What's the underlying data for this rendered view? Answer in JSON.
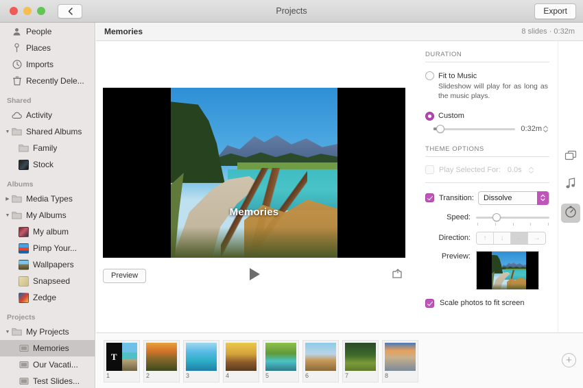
{
  "window": {
    "title": "Projects",
    "back_icon": "chevron-left-icon",
    "export_label": "Export",
    "traffic_lights": [
      "close",
      "minimize",
      "zoom"
    ]
  },
  "sidebar": {
    "items": [
      {
        "label": "People",
        "icon": "person-icon",
        "indent": 0,
        "disclosure": "none",
        "selected": false
      },
      {
        "label": "Places",
        "icon": "map-pin-icon",
        "indent": 0,
        "disclosure": "none",
        "selected": false
      },
      {
        "label": "Imports",
        "icon": "clock-icon",
        "indent": 0,
        "disclosure": "none",
        "selected": false
      },
      {
        "label": "Recently Dele...",
        "icon": "trash-icon",
        "indent": 0,
        "disclosure": "none",
        "selected": false
      }
    ],
    "sections": [
      {
        "header": "Shared",
        "items": [
          {
            "label": "Activity",
            "icon": "cloud-icon",
            "indent": 0,
            "disclosure": "none",
            "selected": false
          },
          {
            "label": "Shared Albums",
            "icon": "folder-icon",
            "indent": 0,
            "disclosure": "expanded",
            "selected": false
          },
          {
            "label": "Family",
            "icon": "folder-icon",
            "indent": 1,
            "disclosure": "none",
            "selected": false
          },
          {
            "label": "Stock",
            "icon": "album-thumbnail-icon",
            "indent": 1,
            "disclosure": "none",
            "selected": false,
            "swatch": "linear-gradient(135deg,#1b1b1b,#3a4a52 60%,#0f0f0f)"
          }
        ]
      },
      {
        "header": "Albums",
        "items": [
          {
            "label": "Media Types",
            "icon": "folder-icon",
            "indent": 0,
            "disclosure": "collapsed",
            "selected": false
          },
          {
            "label": "My Albums",
            "icon": "folder-icon",
            "indent": 0,
            "disclosure": "expanded",
            "selected": false
          },
          {
            "label": "My album",
            "icon": "album-thumbnail-icon",
            "indent": 1,
            "disclosure": "none",
            "selected": false,
            "swatch": "linear-gradient(135deg,#6b2530,#c75a6a 45%,#3a2a3f)"
          },
          {
            "label": "Pimp Your...",
            "icon": "album-thumbnail-icon",
            "indent": 1,
            "disclosure": "none",
            "selected": false,
            "swatch": "linear-gradient(#4aa3e0 0%,#4aa3e0 38%,#e8452c 40%,#e8452c 72%,#1a62a8 74%)"
          },
          {
            "label": "Wallpapers",
            "icon": "album-thumbnail-icon",
            "indent": 1,
            "disclosure": "none",
            "selected": false,
            "swatch": "linear-gradient(#7fc4e8 0%,#7fc4e8 40%,#8a7f55 42%,#4e4a2c 100%)"
          },
          {
            "label": "Snapseed",
            "icon": "album-thumbnail-icon",
            "indent": 1,
            "disclosure": "none",
            "selected": false,
            "swatch": "linear-gradient(135deg,#e8dcae,#cdbd89)"
          },
          {
            "label": "Zedge",
            "icon": "album-thumbnail-icon",
            "indent": 1,
            "disclosure": "none",
            "selected": false,
            "swatch": "linear-gradient(135deg,#2d5fa8,#d8452e 55%,#e8c45a)"
          }
        ]
      },
      {
        "header": "Projects",
        "items": [
          {
            "label": "My Projects",
            "icon": "folder-icon",
            "indent": 0,
            "disclosure": "expanded",
            "selected": false
          },
          {
            "label": "Memories",
            "icon": "slideshow-icon",
            "indent": 1,
            "disclosure": "none",
            "selected": true
          },
          {
            "label": "Our Vacati...",
            "icon": "slideshow-icon",
            "indent": 1,
            "disclosure": "none",
            "selected": false
          },
          {
            "label": "Test Slides...",
            "icon": "slideshow-icon",
            "indent": 1,
            "disclosure": "none",
            "selected": false
          }
        ]
      }
    ]
  },
  "content_header": {
    "title": "Memories",
    "meta": "8 slides · 0:32m"
  },
  "stage": {
    "slide_title": "Memories",
    "preview_button": "Preview",
    "play_icon": "play-icon",
    "loop_icon": "loop-export-icon"
  },
  "inspector": {
    "duration": {
      "section_title": "DURATION",
      "fit_to_music": {
        "label": "Fit to Music",
        "selected": false,
        "help": "Slideshow will play for as long as the music plays."
      },
      "custom": {
        "label": "Custom",
        "selected": true,
        "value": "0:32m",
        "slider_percent": 6
      }
    },
    "theme_options": {
      "section_title": "THEME OPTIONS",
      "play_selected_for": {
        "label": "Play Selected For:",
        "value": "0.0s",
        "checked": false,
        "enabled": false
      },
      "transition": {
        "label": "Transition:",
        "checked": true,
        "value": "Dissolve",
        "options": [
          "Dissolve"
        ]
      },
      "speed": {
        "label": "Speed:",
        "percent": 28
      },
      "direction": {
        "label": "Direction:",
        "options": [
          "up-arrow-icon",
          "down-arrow-icon",
          "left-arrow-icon",
          "right-arrow-icon"
        ],
        "selected_index": 2
      },
      "preview": {
        "label": "Preview:"
      },
      "scale_photos": {
        "label": "Scale photos to fit screen",
        "checked": true
      }
    }
  },
  "rail": {
    "buttons": [
      {
        "icon": "themes-icon",
        "active": false
      },
      {
        "icon": "music-note-icon",
        "active": false
      },
      {
        "icon": "duration-timer-icon",
        "active": true
      }
    ]
  },
  "filmstrip": {
    "add_icon": "add-slide-icon",
    "slides": [
      {
        "number": "1",
        "type": "title",
        "title_letter": "T",
        "swatch": "linear-gradient(#6fc0e6 0%,#6fc0e6 34%,#4fc0c4 36%,#4fc0c4 58%,#b9a57c 60%,#6d6340 100%)"
      },
      {
        "number": "2",
        "type": "photo",
        "swatch": "linear-gradient(#e8a13a 0%,#d4732a 30%,#8a6a2a 55%,#3d4a1e 100%)"
      },
      {
        "number": "3",
        "type": "photo",
        "swatch": "linear-gradient(#9fd8ef 0%,#55b8e4 34%,#2fb0c8 62%,#1f7fa8 100%)"
      },
      {
        "number": "4",
        "type": "photo",
        "swatch": "linear-gradient(#e8c94a 0%,#d4a23a 40%,#8a5a2a 70%,#5a3a20 100%)"
      },
      {
        "number": "5",
        "type": "photo",
        "swatch": "linear-gradient(#8fc04a 0%,#5f9a3a 38%,#49c3c6 66%,#2f7a8a 100%)"
      },
      {
        "number": "6",
        "type": "photo",
        "swatch": "linear-gradient(#8ecbe8 0%,#b9d4e8 40%,#c99a5a 62%,#8a6a3a 100%)"
      },
      {
        "number": "7",
        "type": "photo",
        "swatch": "linear-gradient(#2b4a2a 0%,#3d6a2a 44%,#7a9a3a 72%,#5f7a2a 100%)"
      },
      {
        "number": "8",
        "type": "photo",
        "swatch": "linear-gradient(#4a7ab8 0%,#e8a05a 28%,#c9b08a 52%,#7a8a9a 100%)"
      }
    ]
  }
}
